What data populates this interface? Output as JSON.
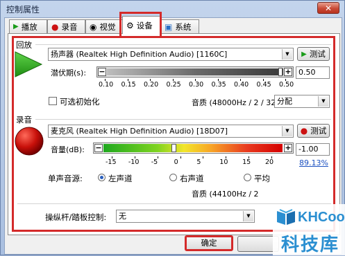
{
  "window": {
    "title": "控制属性",
    "close_glyph": "✕"
  },
  "tabs": [
    {
      "label": "播放",
      "icon": "play-icon",
      "color": "#1a9c1a"
    },
    {
      "label": "录音",
      "icon": "record-icon",
      "color": "#cc1111"
    },
    {
      "label": "视觉",
      "icon": "eye-icon"
    },
    {
      "label": "设备",
      "icon": "device-icon",
      "active": true
    },
    {
      "label": "系统",
      "icon": "system-icon"
    }
  ],
  "playback": {
    "section_label": "回放",
    "device": "扬声器 (Realtek High Definition Audio) [1160C]",
    "test_label": "测试",
    "latency_label": "潜伏期(s):",
    "latency_value": "0.50",
    "latency_level": 0.5,
    "latency_ticks": [
      "0.10",
      "0.15",
      "0.20",
      "0.25",
      "0.30",
      "0.35",
      "0.40",
      "0.45",
      "0.50"
    ],
    "optional_init_label": "可选初始化",
    "optional_init_checked": false,
    "quality_label": "音质 (48000Hz / 2 / 32):",
    "quality_value": "分配"
  },
  "recording": {
    "section_label": "录音",
    "device": "麦克风 (Realtek High Definition Audio) [18D07]",
    "test_label": "测试",
    "volume_label": "音量(dB):",
    "volume_db": "-1.00",
    "volume_percent": "89.13%",
    "volume_level": 0.4,
    "volume_ticks": [
      "-15",
      "-10",
      "-5",
      "0",
      "5",
      "10",
      "15",
      "20"
    ],
    "mono_source_label": "单声音源:",
    "mono_options": [
      {
        "label": "左声道",
        "checked": true
      },
      {
        "label": "右声道",
        "checked": false
      },
      {
        "label": "平均",
        "checked": false
      }
    ],
    "quality_label": "音质 (44100Hz / 2"
  },
  "joystick": {
    "label": "操纵杆/踏板控制:",
    "value": "无"
  },
  "buttons": {
    "ok": "确定"
  },
  "watermark": {
    "brand": "KHCoo",
    "site": "科技库"
  },
  "colors": {
    "highlight_red": "#d42a2a",
    "link_blue": "#1a4fc0"
  }
}
